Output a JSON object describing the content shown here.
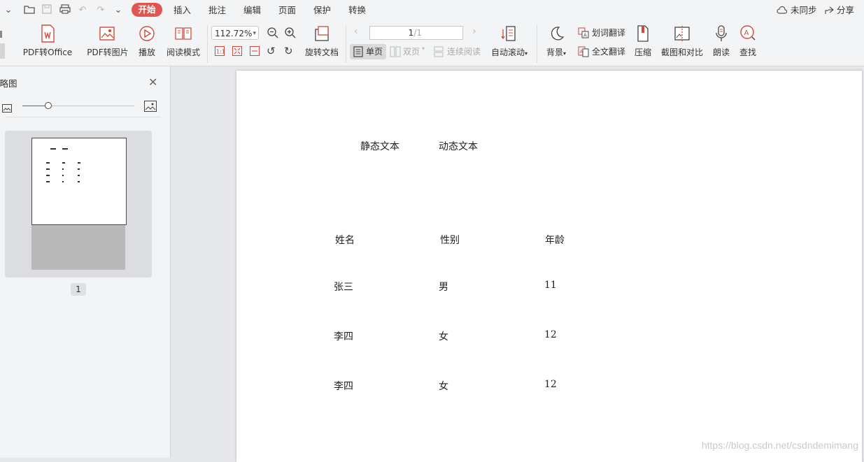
{
  "menubar": {
    "tabs": [
      "开始",
      "插入",
      "批注",
      "编辑",
      "页面",
      "保护",
      "转换"
    ],
    "sync_label": "未同步",
    "share_label": "分享"
  },
  "ribbon": {
    "pdf_to_office": "PDF转Office",
    "pdf_to_image": "PDF转图片",
    "play": "播放",
    "read_mode": "阅读模式",
    "zoom_value": "112.72%",
    "rotate_doc": "旋转文档",
    "page_current": "1",
    "page_total": "/1",
    "single_page": "单页",
    "double_page": "双页",
    "continuous_read": "连续阅读",
    "auto_scroll": "自动滚动",
    "background": "背景",
    "word_translate": "划词翻译",
    "full_translate": "全文翻译",
    "compress": "压缩",
    "screenshot_compare": "截图和对比",
    "read_aloud": "朗读",
    "find": "查找"
  },
  "sidebar": {
    "title": "缩略图",
    "thumbnail_zoom_level": 0.23,
    "page_label": "1"
  },
  "document": {
    "header_static": "静态文本",
    "header_dynamic": "动态文本",
    "table": {
      "columns": [
        "姓名",
        "性别",
        "年龄"
      ],
      "rows": [
        [
          "张三",
          "男",
          "11"
        ],
        [
          "李四",
          "女",
          "12"
        ],
        [
          "李四",
          "女",
          "12"
        ]
      ]
    }
  },
  "watermark": "https://blog.csdn.net/csdndemimang",
  "colors": {
    "accent": "#e25553",
    "page_bg": "#ffffff",
    "workspace_bg": "#e6e7e9"
  }
}
